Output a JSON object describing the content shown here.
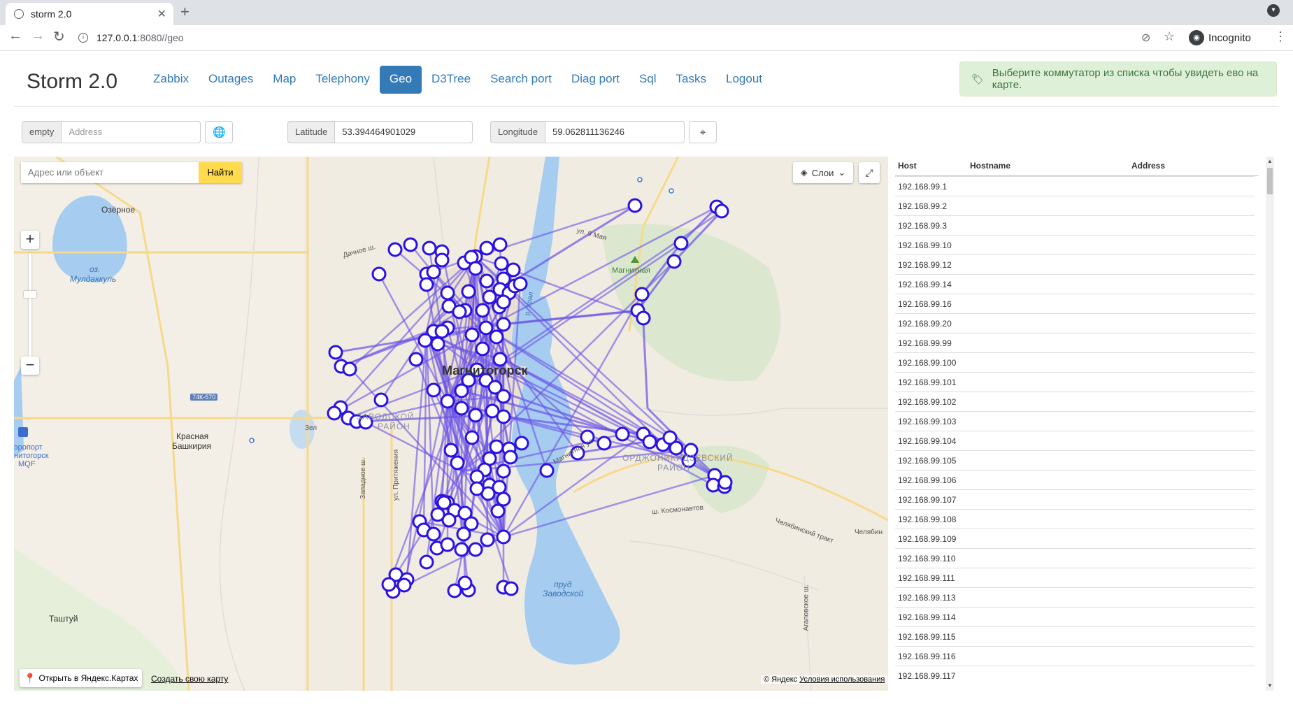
{
  "browser": {
    "tab_title": "storm 2.0",
    "url_host": "127.0.0.1",
    "url_path": ":8080//geo",
    "profile_label": "Incognito"
  },
  "app": {
    "brand": "Storm 2.0",
    "nav": [
      {
        "label": "Zabbix",
        "active": false
      },
      {
        "label": "Outages",
        "active": false
      },
      {
        "label": "Map",
        "active": false
      },
      {
        "label": "Telephony",
        "active": false
      },
      {
        "label": "Geo",
        "active": true
      },
      {
        "label": "D3Tree",
        "active": false
      },
      {
        "label": "Search port",
        "active": false
      },
      {
        "label": "Diag port",
        "active": false
      },
      {
        "label": "Sql",
        "active": false
      },
      {
        "label": "Tasks",
        "active": false
      },
      {
        "label": "Logout",
        "active": false
      }
    ],
    "alert_text": "Выберите коммутатор из списка чтобы увидеть ево на карте."
  },
  "form": {
    "address_addon": "empty",
    "address_placeholder": "Address",
    "latitude_label": "Latitude",
    "latitude_value": "53.394464901029",
    "longitude_label": "Longitude",
    "longitude_value": "59.062811136246"
  },
  "map": {
    "search_placeholder": "Адрес или объект",
    "search_button": "Найти",
    "layers_label": "Слои",
    "open_in_yandex": "Открыть в Яндекс.Картах",
    "create_map": "Создать свою карту",
    "copyright": "© Яндекс",
    "terms": "Условия использования",
    "marker_color": "#2b12e0",
    "link_color": "#6a52e8",
    "labels": {
      "ozerny": "Озёрное",
      "lake1": "оз.",
      "lake2": "Мулдаккуль",
      "road_74k": "74К-570",
      "krasnaya1": "Красная",
      "krasnaya2": "Башкирия",
      "airport1": "эропорт",
      "airport2": "нитогорск",
      "airport3": "MQF",
      "tashtuy": "Таштуй",
      "city": "Магнитогорск",
      "mountain": "Магнитная",
      "district1": "ОРДЖОНИКИДЗЕВСКИЙ",
      "district2": "РАЙОН",
      "district3": "ЗАВОДСКОЙ",
      "district4": "РАЙОН",
      "prud1": "пруд",
      "prud2": "Заводской",
      "road_may": "ул. 9 Мая",
      "road_dach": "Дачное ш.",
      "road_ural": "р. Урал",
      "road_magn": "Магнитная ул.",
      "road_kosm": "ш. Космонавтов",
      "road_chel": "Челябинский тракт",
      "road_chel2": "Челябин",
      "road_zap": "Западное ш.",
      "road_prit": "ул. Притяжения",
      "road_agap": "Агаповское ш.",
      "road_zel": "Зел"
    }
  },
  "table": {
    "headers": [
      "Host",
      "Hostname",
      "Address"
    ],
    "rows": [
      "192.168.99.1",
      "192.168.99.2",
      "192.168.99.3",
      "192.168.99.10",
      "192.168.99.12",
      "192.168.99.14",
      "192.168.99.16",
      "192.168.99.20",
      "192.168.99.99",
      "192.168.99.100",
      "192.168.99.101",
      "192.168.99.102",
      "192.168.99.103",
      "192.168.99.104",
      "192.168.99.105",
      "192.168.99.106",
      "192.168.99.107",
      "192.168.99.108",
      "192.168.99.109",
      "192.168.99.110",
      "192.168.99.111",
      "192.168.99.113",
      "192.168.99.114",
      "192.168.99.115",
      "192.168.99.116",
      "192.168.99.117"
    ]
  }
}
